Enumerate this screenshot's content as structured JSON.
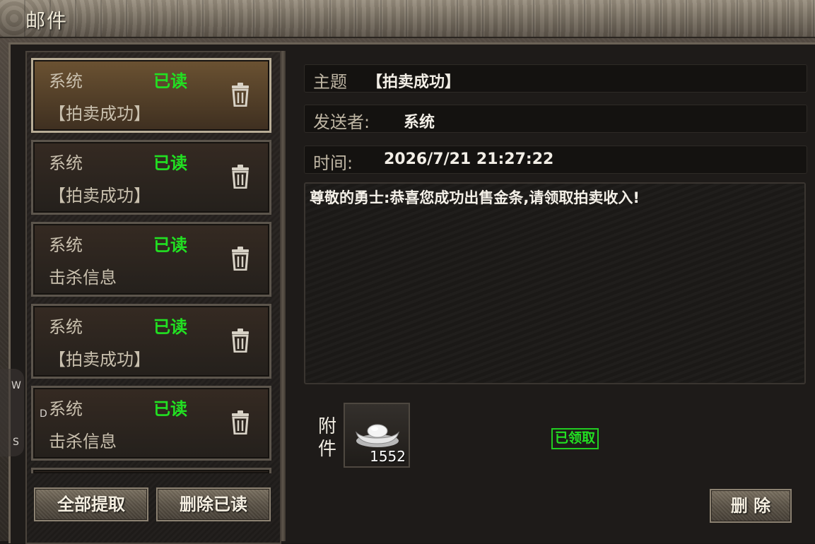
{
  "window": {
    "title": "邮件"
  },
  "mail_list": [
    {
      "sender": "系统",
      "status": "已读",
      "subject": "【拍卖成功】",
      "selected": true
    },
    {
      "sender": "系统",
      "status": "已读",
      "subject": "【拍卖成功】",
      "selected": false
    },
    {
      "sender": "系统",
      "status": "已读",
      "subject": "击杀信息",
      "selected": false
    },
    {
      "sender": "系统",
      "status": "已读",
      "subject": "【拍卖成功】",
      "selected": false
    },
    {
      "sender": "系统",
      "status": "已读",
      "subject": "击杀信息",
      "selected": false
    }
  ],
  "list_buttons": {
    "claim_all": "全部提取",
    "delete_read": "删除已读"
  },
  "detail": {
    "subject_label": "主题",
    "subject_value": "【拍卖成功】",
    "sender_label": "发送者:",
    "sender_value": "系统",
    "time_label": "时间:",
    "time_value": "2026/7/21 21:27:22",
    "body": "尊敬的勇士:恭喜您成功出售金条,请领取拍卖收入!"
  },
  "attachment": {
    "label": "附件",
    "item_icon": "silver-ingot-icon",
    "count": "1552",
    "claimed_badge": "已领取"
  },
  "delete_button": "删 除",
  "side_keys": [
    "W",
    "D",
    "S"
  ],
  "colors": {
    "read_status": "#22e022",
    "claimed": "#22cc22",
    "title_text": "#f0ead8"
  }
}
